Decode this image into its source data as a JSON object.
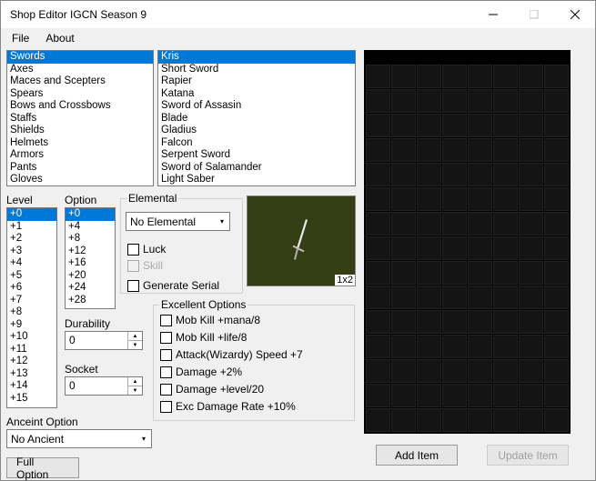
{
  "window": {
    "title": "Shop Editor IGCN Season 9"
  },
  "menu": {
    "file": "File",
    "about": "About"
  },
  "categories": {
    "items": [
      "Swords",
      "Axes",
      "Maces and Scepters",
      "Spears",
      "Bows and Crossbows",
      "Staffs",
      "Shields",
      "Helmets",
      "Armors",
      "Pants",
      "Gloves"
    ],
    "selectedIndex": 0
  },
  "items": {
    "items": [
      "Kris",
      "Short Sword",
      "Rapier",
      "Katana",
      "Sword of Assasin",
      "Blade",
      "Gladius",
      "Falcon",
      "Serpent Sword",
      "Sword of Salamander",
      "Light Saber"
    ],
    "selectedIndex": 0
  },
  "labels": {
    "level": "Level",
    "option": "Option",
    "elemental": "Elemental",
    "durability": "Durability",
    "socket": "Socket",
    "ancient": "Anceint Option",
    "excellent": "Excellent Options"
  },
  "level": {
    "items": [
      "+0",
      "+1",
      "+2",
      "+3",
      "+4",
      "+5",
      "+6",
      "+7",
      "+8",
      "+9",
      "+10",
      "+11",
      "+12",
      "+13",
      "+14",
      "+15"
    ],
    "selectedIndex": 0
  },
  "option": {
    "items": [
      "+0",
      "+4",
      "+8",
      "+12",
      "+16",
      "+20",
      "+24",
      "+28"
    ],
    "selectedIndex": 0
  },
  "elemental": {
    "value": "No Elemental"
  },
  "checkboxes": {
    "luck": "Luck",
    "skill": "Skill",
    "generate_serial": "Generate Serial"
  },
  "durability": {
    "value": "0"
  },
  "socket": {
    "value": "0"
  },
  "excellent": {
    "opts": [
      "Mob Kill +mana/8",
      "Mob Kill +life/8",
      "Attack(Wizardy) Speed +7",
      "Damage +2%",
      "Damage +level/20",
      "Exc Damage Rate +10%"
    ]
  },
  "ancient": {
    "value": "No Ancient"
  },
  "preview": {
    "size": "1x2"
  },
  "buttons": {
    "full_option": "Full Option",
    "add_item": "Add Item",
    "update_item": "Update Item"
  }
}
